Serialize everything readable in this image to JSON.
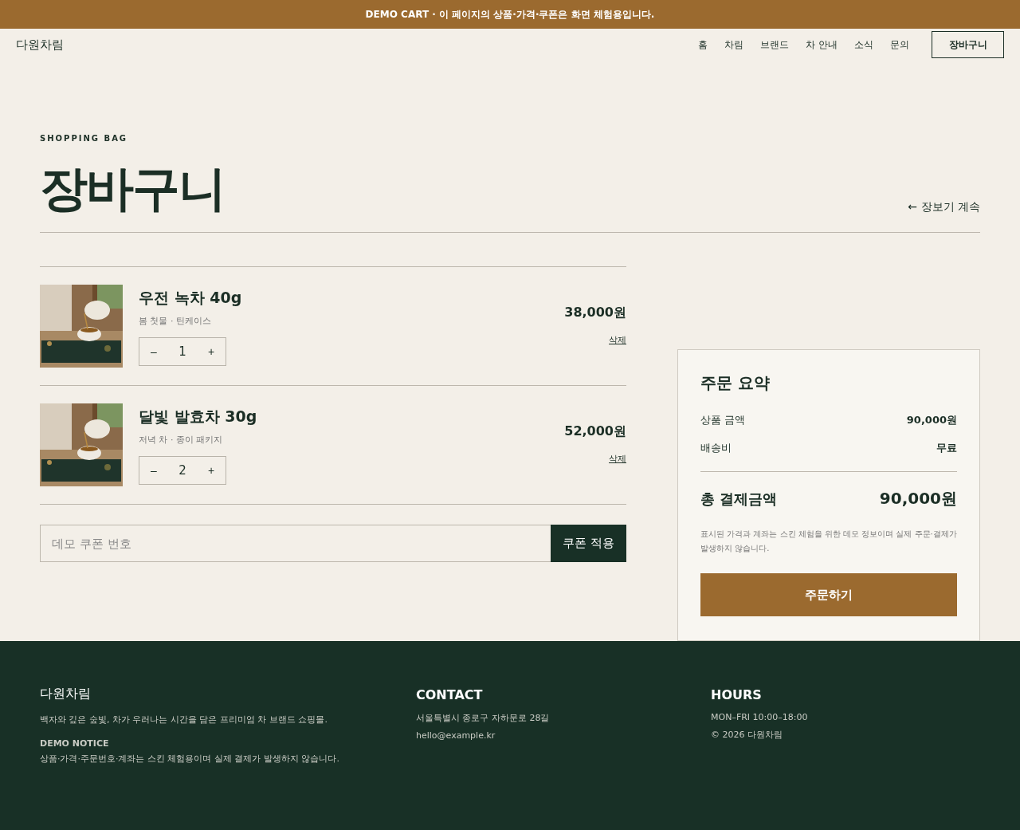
{
  "banner": "DEMO CART · 이 페이지의 상품·가격·쿠폰은 화면 체험용입니다.",
  "header": {
    "brand": "다원차림",
    "nav": [
      "홈",
      "차림",
      "브랜드",
      "차 안내",
      "소식",
      "문의"
    ],
    "cart_button": "장바구니"
  },
  "page": {
    "eyebrow": "SHOPPING BAG",
    "title": "장바구니",
    "continue_link": "← 장보기 계속"
  },
  "items": [
    {
      "name": "우전 녹차 40g",
      "options": "봄 첫물 · 틴케이스",
      "quantity": "1",
      "decrement": "–",
      "increment": "+",
      "price": "38,000원",
      "remove": "삭제"
    },
    {
      "name": "달빛 발효차 30g",
      "options": "저녁 차 · 종이 패키지",
      "quantity": "2",
      "decrement": "–",
      "increment": "+",
      "price": "52,000원",
      "remove": "삭제"
    }
  ],
  "coupon": {
    "placeholder": "데모 쿠폰 번호",
    "button": "쿠폰 적용"
  },
  "summary": {
    "title": "주문 요약",
    "rows": [
      {
        "label": "상품 금액",
        "value": "90,000원"
      },
      {
        "label": "배송비",
        "value": "무료"
      }
    ],
    "total_label": "총 결제금액",
    "total_value": "90,000원",
    "note": "표시된 가격과 계좌는 스킨 체험을 위한 데모 정보이며 실제 주문·결제가 발생하지 않습니다.",
    "order_button": "주문하기"
  },
  "footer": {
    "brand": "다원차림",
    "tagline": "백자와 깊은 숲빛, 차가 우러나는 시간을 담은 프리미엄 차 브랜드 쇼핑몰.",
    "notice_title": "DEMO NOTICE",
    "notice": "상품·가격·주문번호·계좌는 스킨 체험용이며 실제 결제가 발생하지 않습니다.",
    "columns": [
      {
        "title": "CONTACT",
        "lines": [
          "서울특별시 종로구 자하문로 28길",
          "hello@example.kr"
        ]
      },
      {
        "title": "HOURS",
        "lines": [
          "MON–FRI 10:00–18:00",
          "© 2026 다원차림"
        ]
      }
    ]
  }
}
